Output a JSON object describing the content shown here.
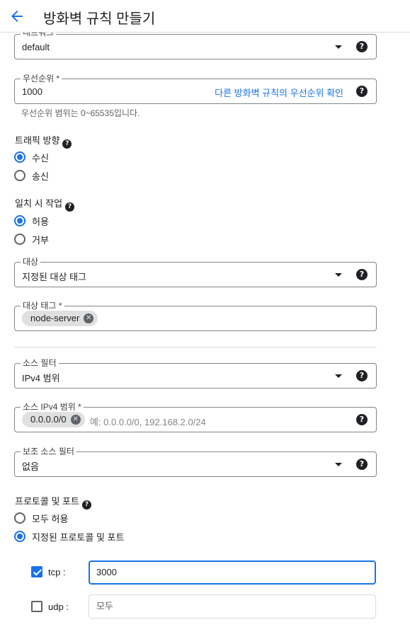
{
  "header": {
    "title": "방화벽 규칙 만들기"
  },
  "network": {
    "label": "네트워크",
    "value": "default"
  },
  "priority": {
    "label": "우선순위 *",
    "value": "1000",
    "link": "다른 방화벽 규칙의 우선순위 확인",
    "hint": "우선순위 범위는 0~65535입니다."
  },
  "direction": {
    "title": "트래픽 방향",
    "options": [
      "수신",
      "송신"
    ],
    "selected": "수신"
  },
  "action": {
    "title": "일치 시 작업",
    "options": [
      "허용",
      "거부"
    ],
    "selected": "허용"
  },
  "targets": {
    "label": "대상",
    "value": "지정된 대상 태그"
  },
  "target_tags": {
    "label": "대상 태그 *",
    "chips": [
      "node-server"
    ]
  },
  "source_filter": {
    "label": "소스 필터",
    "value": "IPv4 범위"
  },
  "source_ranges": {
    "label": "소스 IPv4 범위 *",
    "chips": [
      "0.0.0.0/0"
    ],
    "placeholder": "예: 0.0.0.0/0, 192.168.2.0/24"
  },
  "second_filter": {
    "label": "보조 소스 필터",
    "value": "없음"
  },
  "protocols": {
    "title": "프로토콜 및 포트",
    "options": [
      "모두 허용",
      "지정된 프로토콜 및 포트"
    ],
    "selected": "지정된 프로토콜 및 포트",
    "tcp": {
      "label": "tcp :",
      "checked": true,
      "value": "3000"
    },
    "udp": {
      "label": "udp :",
      "checked": false,
      "placeholder": "모두"
    }
  },
  "colors": {
    "accent": "#1a73e8",
    "text": "#202124",
    "border": "#80868b"
  },
  "icons": {
    "back": "arrow-left-icon",
    "help": "help-circle-icon",
    "dropdown": "caret-down-icon",
    "chip_remove": "cancel-circle-icon"
  }
}
